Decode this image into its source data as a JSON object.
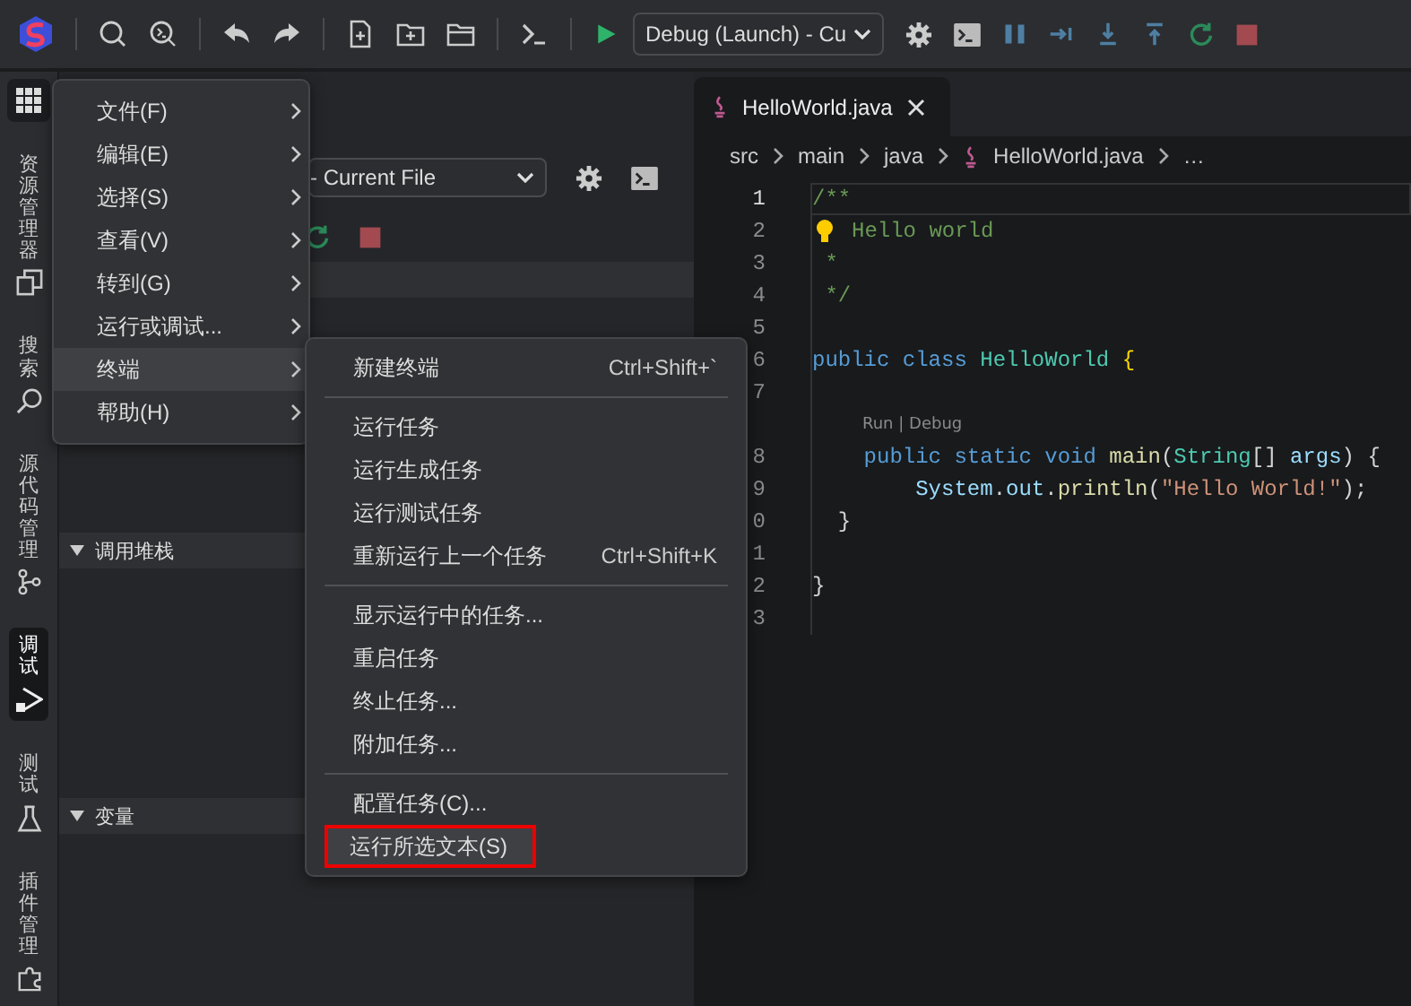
{
  "toolbar": {
    "launch_config": "Debug (Launch) - Cu"
  },
  "activity_bar": [
    {
      "label": "资源管理器",
      "selected": false
    },
    {
      "label": "搜索",
      "selected": false
    },
    {
      "label": "源代码管理",
      "selected": false
    },
    {
      "label": "调试",
      "selected": true
    },
    {
      "label": "测试",
      "selected": false
    },
    {
      "label": "插件管理",
      "selected": false
    }
  ],
  "debug_panel": {
    "config": "- Current File",
    "sections": [
      {
        "title": "调用堆栈",
        "expanded": true
      },
      {
        "title": "变量",
        "expanded": true
      }
    ]
  },
  "menu": [
    {
      "label": "文件(F)",
      "selected": false
    },
    {
      "label": "编辑(E)",
      "selected": false
    },
    {
      "label": "选择(S)",
      "selected": false
    },
    {
      "label": "查看(V)",
      "selected": false
    },
    {
      "label": "转到(G)",
      "selected": false
    },
    {
      "label": "运行或调试...",
      "selected": false
    },
    {
      "label": "终端",
      "selected": true
    },
    {
      "label": "帮助(H)",
      "selected": false
    }
  ],
  "submenu": [
    [
      {
        "label": "新建终端",
        "shortcut": "Ctrl+Shift+`",
        "selected": false,
        "annotated": false
      }
    ],
    [
      {
        "label": "运行任务",
        "selected": false,
        "annotated": false
      },
      {
        "label": "运行生成任务",
        "selected": false,
        "annotated": false
      },
      {
        "label": "运行测试任务",
        "selected": false,
        "annotated": false
      },
      {
        "label": "重新运行上一个任务",
        "shortcut": "Ctrl+Shift+K",
        "selected": false,
        "annotated": false
      }
    ],
    [
      {
        "label": "显示运行中的任务...",
        "selected": false,
        "annotated": false
      },
      {
        "label": "重启任务",
        "selected": false,
        "annotated": false
      },
      {
        "label": "终止任务...",
        "selected": false,
        "annotated": false
      },
      {
        "label": "附加任务...",
        "selected": false,
        "annotated": false
      }
    ],
    [
      {
        "label": "配置任务(C)...",
        "selected": false,
        "annotated": false
      },
      {
        "label": "运行所选文本(S)",
        "selected": true,
        "annotated": true
      }
    ]
  ],
  "editor": {
    "tab": {
      "title": "HelloWorld.java",
      "selected": true
    },
    "breadcrumbs": [
      "src",
      "main",
      "java",
      "HelloWorld.java",
      "…"
    ],
    "lines": [
      {
        "kind": "code",
        "number": "1",
        "current": true,
        "tokens": [
          {
            "kind": "comment",
            "text": "/**"
          }
        ]
      },
      {
        "kind": "code",
        "number": "2",
        "lightbulb": true,
        "tokens": [
          {
            "kind": "comment",
            "text": "Hello world"
          }
        ]
      },
      {
        "kind": "code",
        "number": "3",
        "tokens": [
          {
            "kind": "comment",
            "text": " *"
          }
        ]
      },
      {
        "kind": "code",
        "number": "4",
        "tokens": [
          {
            "kind": "comment",
            "text": " */"
          }
        ]
      },
      {
        "kind": "code",
        "number": "5"
      },
      {
        "kind": "code",
        "number": "6",
        "tokens": [
          {
            "kind": "keyword",
            "text": "public class "
          },
          {
            "kind": "type",
            "text": "HelloWorld "
          },
          {
            "kind": "brace",
            "text": "{"
          }
        ]
      },
      {
        "kind": "code",
        "number": "7"
      },
      {
        "kind": "codelens",
        "text": "Run | Debug"
      },
      {
        "kind": "code",
        "number": "8",
        "tokens": [
          {
            "kind": "keyword",
            "text": "    public static void "
          },
          {
            "kind": "func",
            "text": "main"
          },
          {
            "kind": "punct",
            "text": "("
          },
          {
            "kind": "type",
            "text": "String"
          },
          {
            "kind": "punct",
            "text": "[] "
          },
          {
            "kind": "var",
            "text": "args"
          },
          {
            "kind": "punct",
            "text": ") {"
          }
        ]
      },
      {
        "kind": "code",
        "number": "9",
        "tokens": [
          {
            "kind": "var",
            "text": "        System"
          },
          {
            "kind": "punct",
            "text": "."
          },
          {
            "kind": "var",
            "text": "out"
          },
          {
            "kind": "punct",
            "text": "."
          },
          {
            "kind": "func",
            "text": "println"
          },
          {
            "kind": "punct",
            "text": "("
          },
          {
            "kind": "string",
            "text": "\"Hello World!\""
          },
          {
            "kind": "punct",
            "text": ");"
          }
        ]
      },
      {
        "kind": "code",
        "number": "0",
        "tokens": [
          {
            "kind": "punct",
            "text": "  }"
          }
        ]
      },
      {
        "kind": "code",
        "number": "1"
      },
      {
        "kind": "code",
        "number": "2",
        "tokens": [
          {
            "kind": "punct",
            "text": "}"
          }
        ]
      },
      {
        "kind": "code",
        "number": "3"
      }
    ]
  }
}
